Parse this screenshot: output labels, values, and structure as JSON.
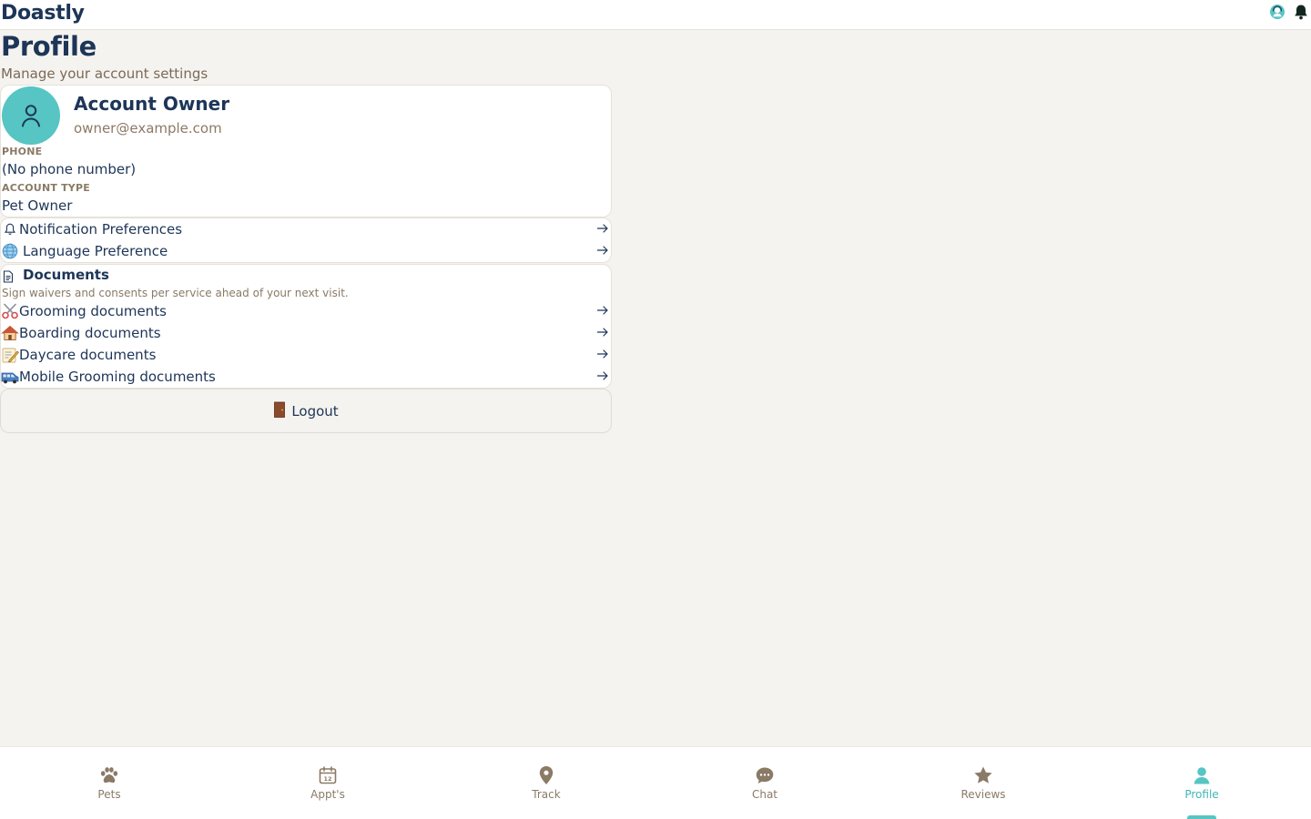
{
  "app": {
    "name": "Doastly"
  },
  "colors": {
    "accent": "#56c5c3",
    "navy": "#1d3557",
    "muted": "#8a7a66",
    "background": "#f5f3ef"
  },
  "page": {
    "title": "Profile",
    "subtitle": "Manage your account settings"
  },
  "profile": {
    "name": "Account Owner",
    "email": "owner@example.com",
    "phone_label": "PHONE",
    "phone_value": "(No phone number)",
    "account_type_label": "ACCOUNT TYPE",
    "account_type_value": "Pet Owner"
  },
  "settings": [
    {
      "label": "Notification Preferences",
      "icon": "bell-icon"
    },
    {
      "label": "Language Preference",
      "icon": "globe-icon"
    }
  ],
  "documents": {
    "title": "Documents",
    "subtitle": "Sign waivers and consents per service ahead of your next visit.",
    "items": [
      {
        "label": "Grooming documents",
        "icon": "scissors-icon"
      },
      {
        "label": "Boarding documents",
        "icon": "house-icon"
      },
      {
        "label": "Daycare documents",
        "icon": "memo-icon"
      },
      {
        "label": "Mobile Grooming documents",
        "icon": "van-icon"
      }
    ]
  },
  "logout": {
    "label": "Logout",
    "icon": "door-icon"
  },
  "nav": [
    {
      "label": "Pets",
      "icon": "paw-icon",
      "active": false
    },
    {
      "label": "Appt's",
      "icon": "calendar-icon",
      "active": false
    },
    {
      "label": "Track",
      "icon": "map-pin-icon",
      "active": false
    },
    {
      "label": "Chat",
      "icon": "chat-bubble-icon",
      "active": false
    },
    {
      "label": "Reviews",
      "icon": "star-icon",
      "active": false
    },
    {
      "label": "Profile",
      "icon": "user-icon",
      "active": true
    }
  ]
}
